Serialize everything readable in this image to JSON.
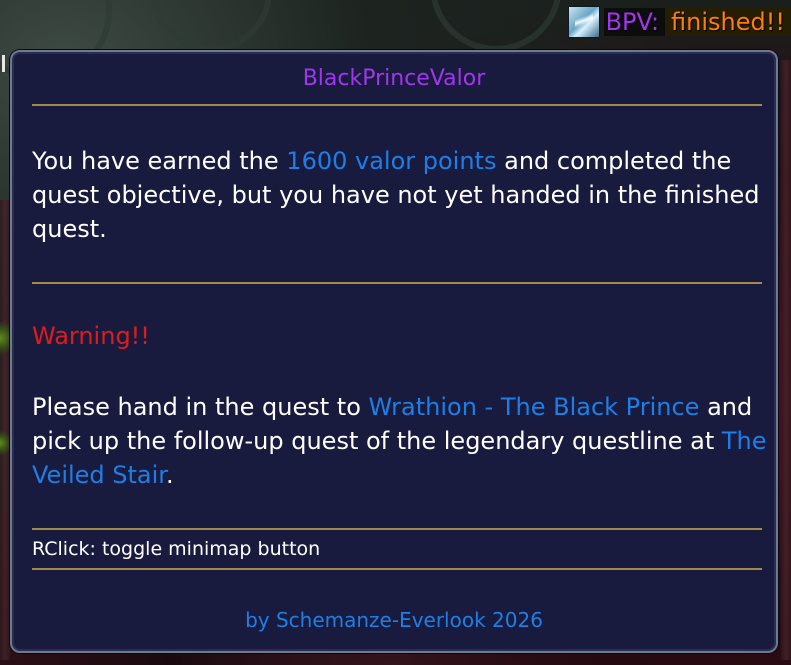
{
  "broker": {
    "icon": "addon-icon",
    "label": "BPV:",
    "status": "finished!!"
  },
  "tooltip": {
    "title": "BlackPrinceValor",
    "message": {
      "part1": "You have earned the ",
      "highlight": "1600 valor points",
      "part2": " and completed the quest objective, but you have not yet handed in the finished quest."
    },
    "warning": "Warning!!",
    "instruction": {
      "part1": "Please hand in the quest to ",
      "npc": "Wrathion - The Black Prince",
      "part2": " and pick up the follow-up quest of the legendary questline at ",
      "location": "The Veiled Stair",
      "part3": "."
    },
    "hint": "RClick: toggle minimap button",
    "footer": "by Schemanze-Everlook 2026"
  },
  "colors": {
    "title": "#a335ee",
    "highlight": "#1f7ee6",
    "warning": "#e01b1b",
    "divider": "#a08a4c",
    "background": "#191b3e",
    "status": "#ff7d0a"
  }
}
